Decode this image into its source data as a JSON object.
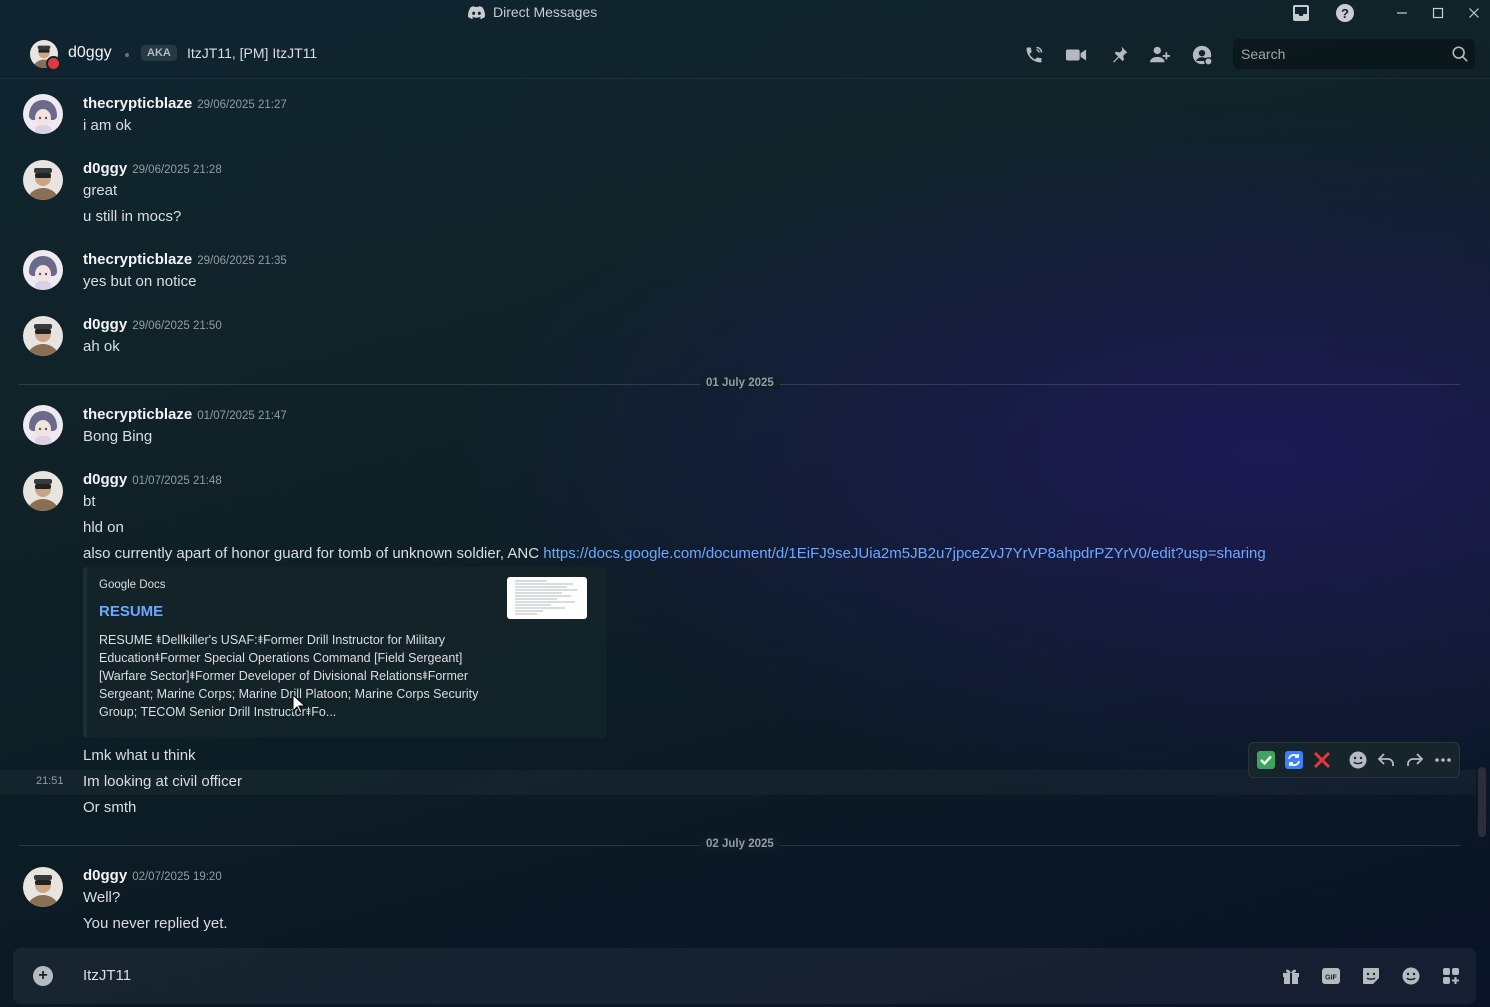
{
  "titlebar": {
    "title": "Direct Messages"
  },
  "header": {
    "username": "d0ggy",
    "aka_badge": "AKA",
    "aka_names": "ItzJT11, [PM] ItzJT11",
    "search_placeholder": "Search"
  },
  "messages": [
    {
      "user": "thecrypticblaze",
      "timestamp": "29/06/2025 21:27",
      "lines": [
        "i am ok"
      ]
    },
    {
      "user": "d0ggy",
      "timestamp": "29/06/2025 21:28",
      "lines": [
        "great",
        "u still in mocs?"
      ]
    },
    {
      "user": "thecrypticblaze",
      "timestamp": "29/06/2025 21:35",
      "lines": [
        "yes but on notice"
      ]
    },
    {
      "user": "d0ggy",
      "timestamp": "29/06/2025 21:50",
      "lines": [
        "ah ok"
      ]
    },
    {
      "user": "thecrypticblaze",
      "timestamp": "01/07/2025 21:47",
      "lines": [
        "Bong Bing"
      ]
    },
    {
      "user": "d0ggy",
      "timestamp": "01/07/2025 21:48",
      "lines": [
        "bt",
        "hld on"
      ],
      "line3_text": "also currently apart of honor guard for tomb of unknown soldier, ANC ",
      "line3_link": "https://docs.google.com/document/d/1EiFJ9seJUia2m5JB2u7jpceZvJ7YrVP8ahpdrPZYrV0/edit?usp=sharing",
      "after_embed": [
        "Lmk what u think",
        "Im looking at civil officer",
        "Or smth"
      ]
    },
    {
      "user": "d0ggy",
      "timestamp": "02/07/2025 19:20",
      "lines": [
        "Well?",
        "You never replied yet."
      ]
    }
  ],
  "dividers": [
    "01 July 2025",
    "02 July 2025"
  ],
  "hover_time": "21:51",
  "embed": {
    "provider": "Google Docs",
    "title": "RESUME",
    "description": "RESUME ⯒Dellkiller's USAF:⯒Former Drill Instructor for Military Education⯒Former Special Operations Command [Field Sergeant] [Warfare Sector]⯒Former Developer of Divisional Relations⯒Former Sergeant; Marine Corps; Marine Drill Platoon; Marine Corps Security Group; TECOM Senior Drill Instructor⯒Fo..."
  },
  "composer": {
    "text": "ItzJT11"
  },
  "colors": {
    "accent_link": "#6da8ff",
    "status_dnd": "#e03a3e",
    "check_green": "#3ba55d",
    "cross_red": "#e03a3e",
    "refresh_blue": "#3b82f6"
  },
  "icons": {
    "titlebar": [
      "discord-logo",
      "inbox",
      "help",
      "minimize",
      "maximize",
      "close"
    ],
    "header": [
      "voice-call",
      "video-call",
      "pinned-messages",
      "add-friends-to-dm",
      "user-profile",
      "search"
    ],
    "message_toolbar": [
      "check-reaction",
      "refresh-reaction",
      "cross-reaction",
      "add-reaction",
      "reply",
      "forward",
      "more"
    ],
    "composer": [
      "add",
      "gift",
      "gif",
      "sticker",
      "emoji",
      "apps"
    ]
  }
}
